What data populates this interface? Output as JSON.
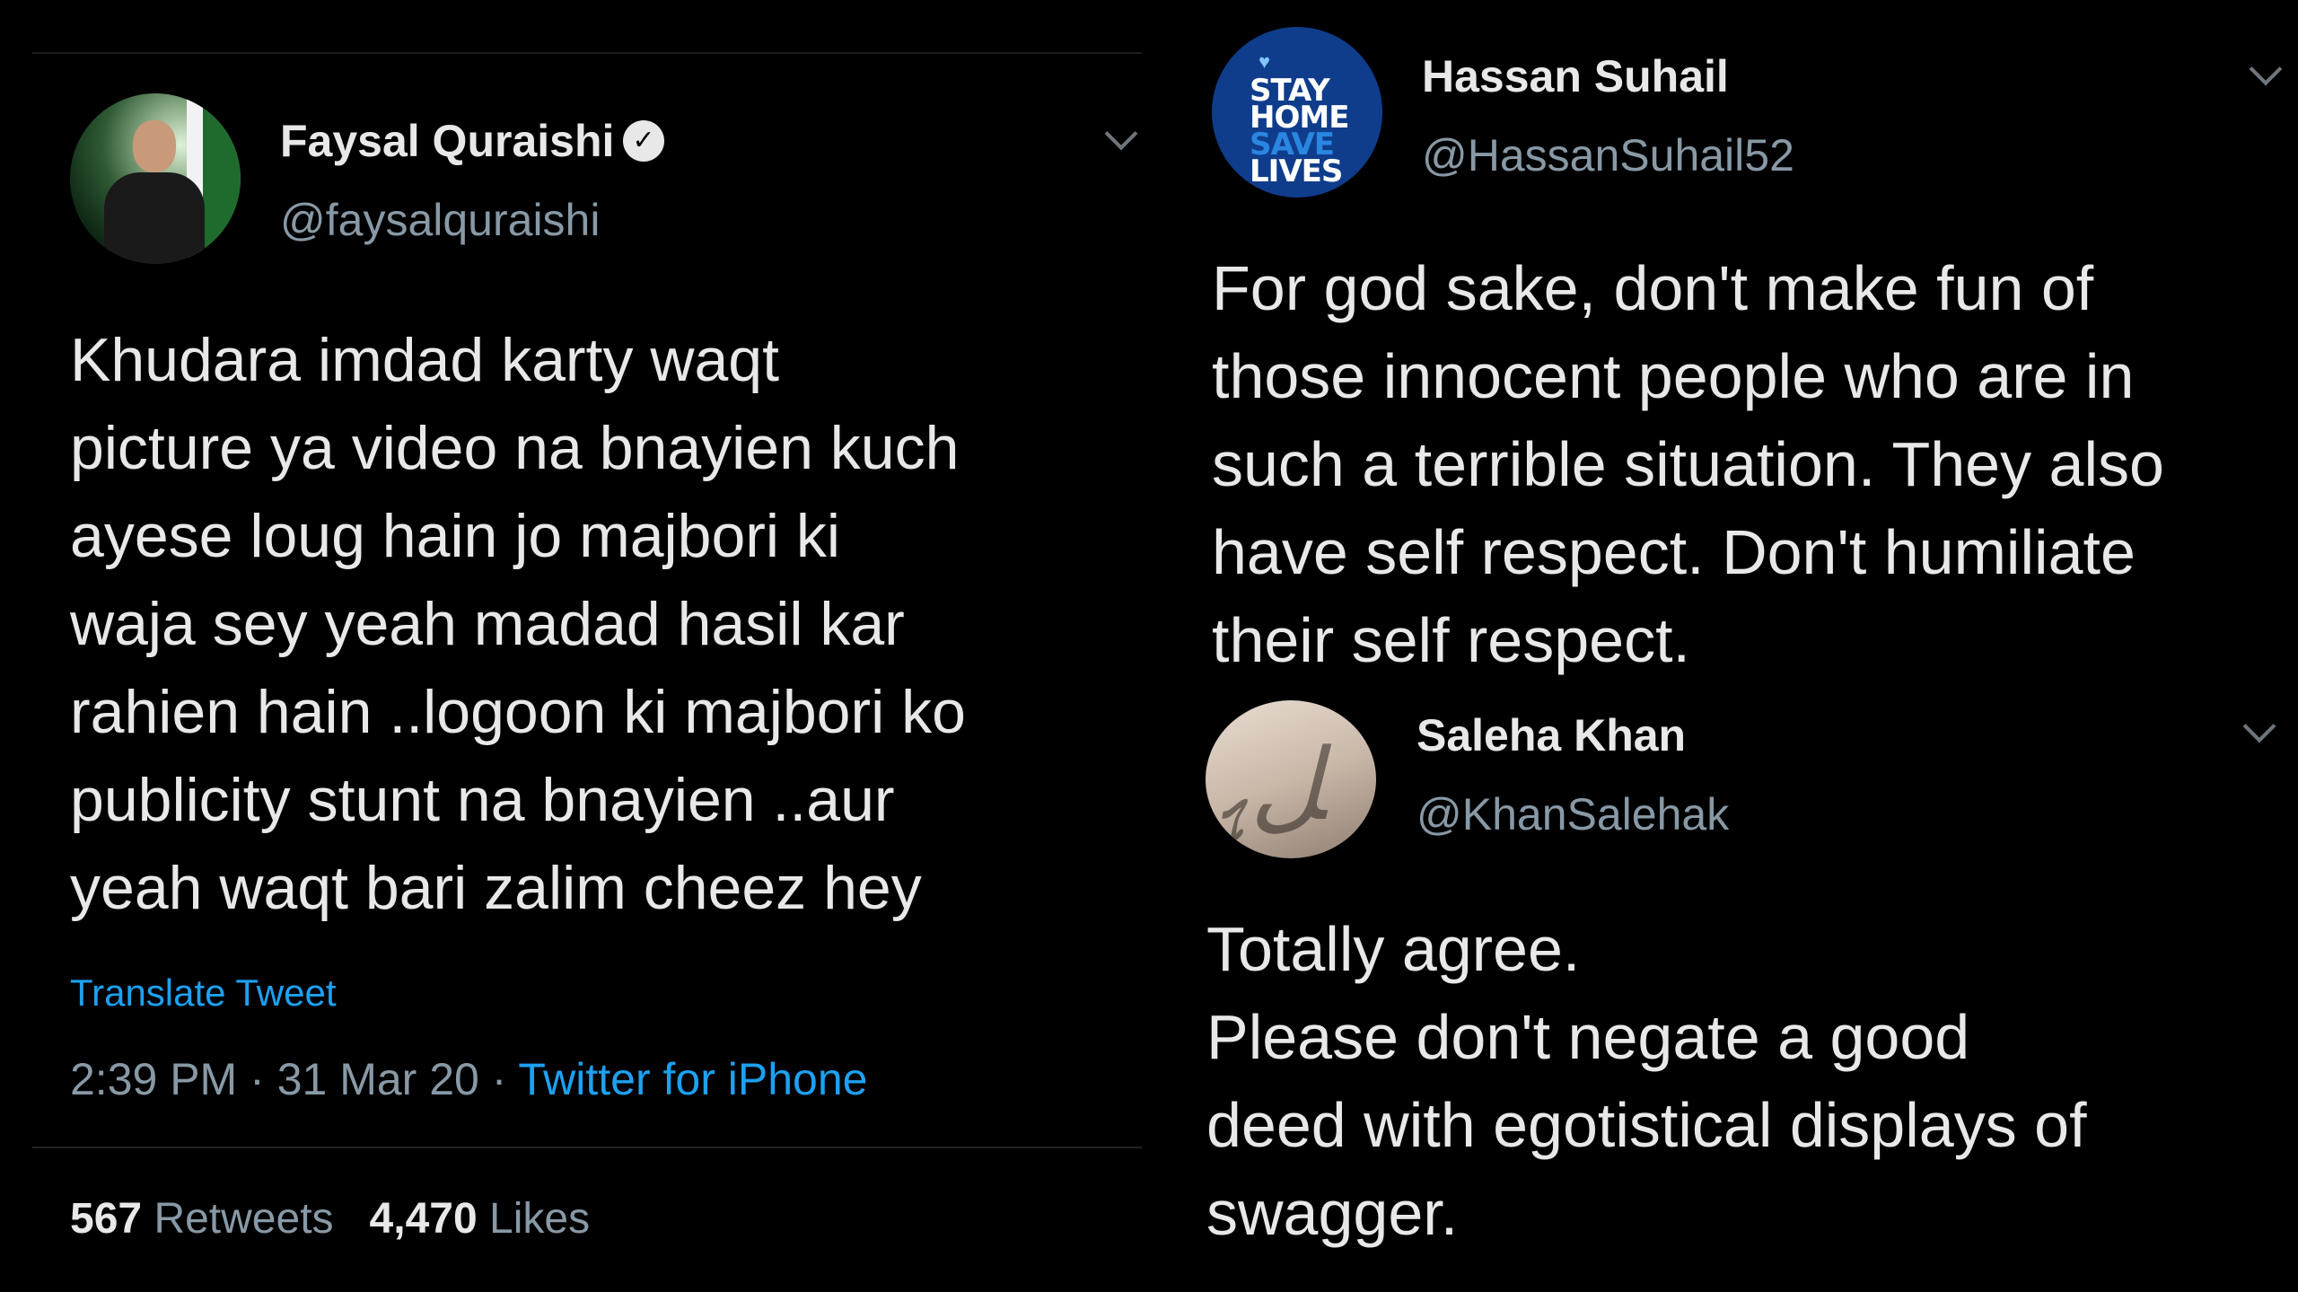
{
  "left_tweet": {
    "author_name": "Faysal Quraishi",
    "author_handle": "@faysalquraishi",
    "verified_icon": "verified-badge-icon",
    "text_lines": [
      "Khudara imdad karty waqt",
      "picture ya video na bnayien kuch",
      "ayese loug hain jo majbori ki",
      "waja sey yeah madad hasil kar",
      "rahien hain ..logoon ki majbori ko",
      "publicity stunt na bnayien ..aur",
      "yeah waqt bari zalim cheez hey"
    ],
    "translate_label": "Translate Tweet",
    "time": "2:39 PM",
    "date": "31 Mar 20",
    "source": "Twitter for iPhone",
    "separator": "·",
    "retweets_count": "567",
    "retweets_label": "Retweets",
    "likes_count": "4,470",
    "likes_label": "Likes"
  },
  "reply_1": {
    "author_name": "Hassan Suhail",
    "author_handle": "@HassanSuhail52",
    "avatar_text": [
      "STAY",
      "HOME",
      "SAVE",
      "LIVES"
    ],
    "text_lines": [
      "For god sake, don't make fun of",
      "those innocent people who are in",
      "such a terrible situation. They also",
      "have self respect. Don't humiliate",
      "their self respect."
    ]
  },
  "reply_2": {
    "author_name": "Saleha Khan",
    "author_handle": "@KhanSalehak",
    "text_lines": [
      "Totally agree.",
      "Please don't negate a good",
      "deed with egotistical displays of",
      "swagger."
    ]
  },
  "colors": {
    "background": "#000000",
    "text": "#e8e8e8",
    "muted": "#8899a6",
    "link": "#1da1f2",
    "stay_home_bg": "#0f3d8c"
  }
}
